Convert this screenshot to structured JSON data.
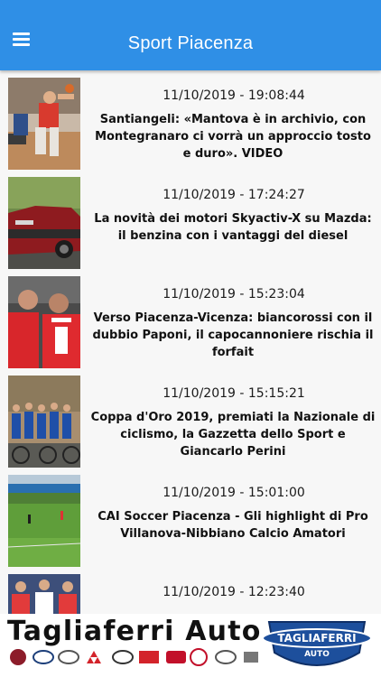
{
  "header": {
    "title": "Sport Piacenza",
    "menu_icon": "hamburger-menu-icon"
  },
  "articles": [
    {
      "date": "11/10/2019 - 19:08:44",
      "title": "Santiangeli: «Mantova è in archivio, con Montegranaro ci vorrà un approccio tosto e duro». VIDEO"
    },
    {
      "date": "11/10/2019 - 17:24:27",
      "title": "La novità dei motori Skyactiv-X su Mazda: il benzina con i vantaggi del diesel"
    },
    {
      "date": "11/10/2019 - 15:23:04",
      "title": "Verso Piacenza-Vicenza: biancorossi con il dubbio Paponi, il capocannoniere rischia il forfait"
    },
    {
      "date": "11/10/2019 - 15:15:21",
      "title": "Coppa d'Oro 2019, premiati la Nazionale di ciclismo, la Gazzetta dello Sport e Giancarlo Perini"
    },
    {
      "date": "11/10/2019 - 15:01:00",
      "title": "CAI Soccer Piacenza - Gli highlight di Pro Villanova-Nibbiano Calcio Amatori"
    },
    {
      "date": "11/10/2019 - 12:23:40",
      "title": ""
    }
  ],
  "ad": {
    "name": "Tagliaferri Auto",
    "badge_line1": "TAGLIAFERRI",
    "badge_line2": "AUTO",
    "brands": [
      "FIAT",
      "HYUNDAI",
      "MITSUBISHI",
      "MAZDA",
      "DAIHATSU",
      "ABARTH",
      "Mahindra",
      "CACCIONCAR",
      "dr"
    ],
    "colors": {
      "brand_blue": "#1d4f9c",
      "header_blue": "#2f8fe6"
    }
  }
}
